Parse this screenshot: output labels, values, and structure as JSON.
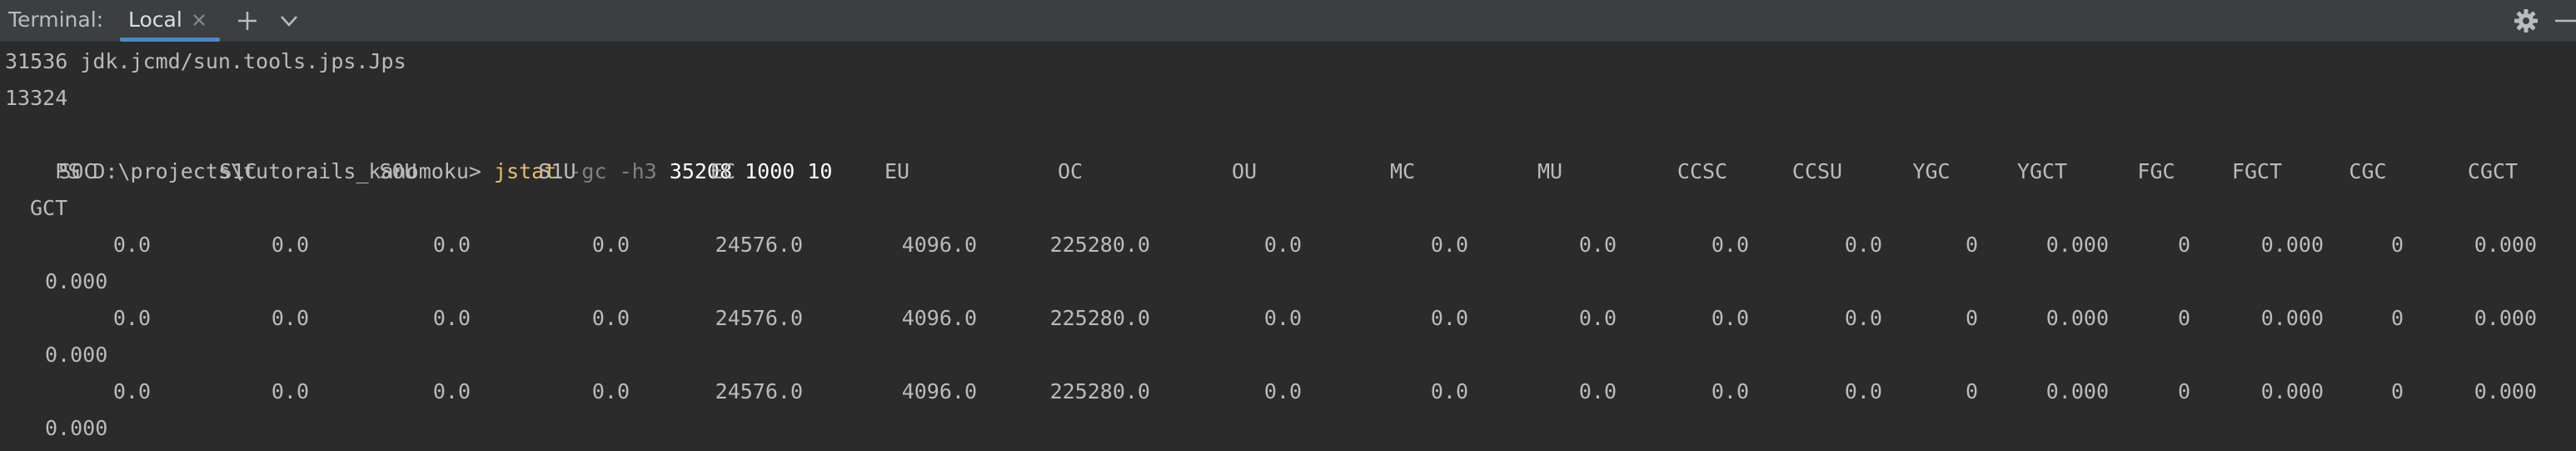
{
  "toolbar": {
    "title": "Terminal:",
    "tab_label": "Local",
    "icons": {
      "close": "close-icon",
      "add": "plus-icon",
      "dropdown": "chevron-down-icon",
      "settings": "gear-icon",
      "minimize": "minimize-icon"
    },
    "accent_color": "#4a88c7"
  },
  "terminal": {
    "lines": [
      "31536 jdk.jcmd/sun.tools.jps.Jps",
      "13324"
    ],
    "prompt": "PS D:\\projects\\tutorails_kanomoku> ",
    "command": {
      "name": "jstat",
      "flag1": "-gc",
      "flag2": "-h3",
      "args": "35208 1000 10"
    },
    "headers": [
      "S0C",
      "S1C",
      "S0U",
      "S1U",
      "EC",
      "EU",
      "OC",
      "OU",
      "MC",
      "MU",
      "CCSC",
      "CCSU",
      "YGC",
      "YGCT",
      "FGC",
      "FGCT",
      "CGC",
      "CGCT"
    ],
    "header_wrap": "GCT",
    "rows": [
      {
        "values": [
          "0.0",
          "0.0",
          "0.0",
          "0.0",
          "24576.0",
          "4096.0",
          "225280.0",
          "0.0",
          "0.0",
          "0.0",
          "0.0",
          "0.0",
          "0",
          "0.000",
          "0",
          "0.000",
          "0",
          "0.000"
        ],
        "wrap": "0.000"
      },
      {
        "values": [
          "0.0",
          "0.0",
          "0.0",
          "0.0",
          "24576.0",
          "4096.0",
          "225280.0",
          "0.0",
          "0.0",
          "0.0",
          "0.0",
          "0.0",
          "0",
          "0.000",
          "0",
          "0.000",
          "0",
          "0.000"
        ],
        "wrap": "0.000"
      },
      {
        "values": [
          "0.0",
          "0.0",
          "0.0",
          "0.0",
          "24576.0",
          "4096.0",
          "225280.0",
          "0.0",
          "0.0",
          "0.0",
          "0.0",
          "0.0",
          "0",
          "0.000",
          "0",
          "0.000",
          "0",
          "0.000"
        ],
        "wrap": "0.000"
      }
    ],
    "colors": {
      "command": "#e8bf6a",
      "flag": "#808080",
      "text": "#bbbbbb"
    }
  }
}
